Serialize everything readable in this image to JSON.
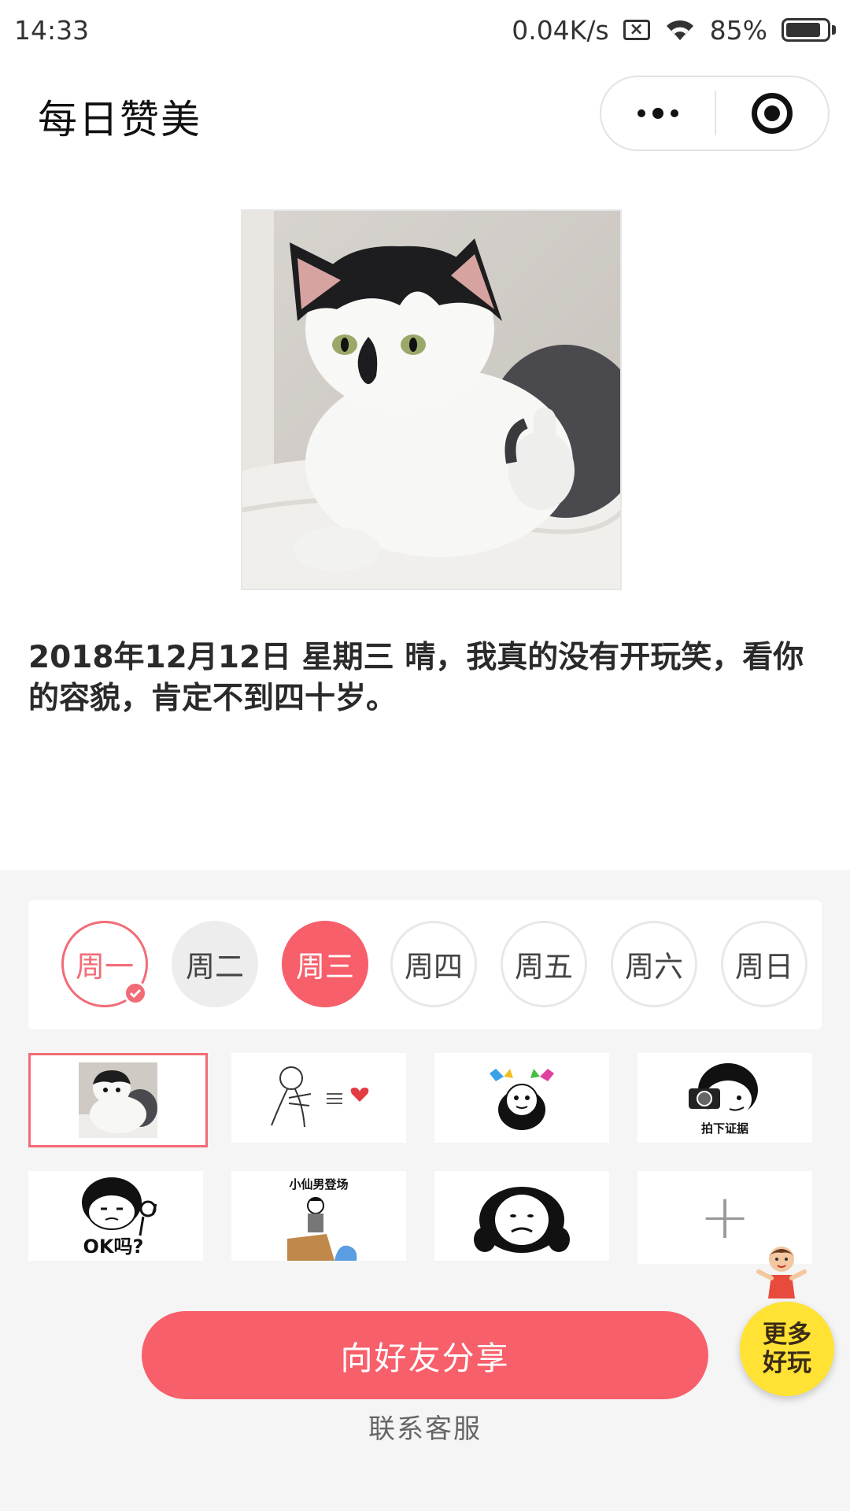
{
  "status_bar": {
    "time": "14:33",
    "network_speed": "0.04K/s",
    "battery_percent": "85%",
    "battery_level": 0.85,
    "icons": [
      "sim-disabled-icon",
      "wifi-icon",
      "battery-icon"
    ]
  },
  "nav": {
    "title": "每日赞美",
    "more_icon": "more-dots-icon",
    "close_icon": "target-close-icon"
  },
  "message": "2018年12月12日 星期三 晴，我真的没有开玩笑，看你的容貌，肯定不到四十岁。",
  "days": [
    {
      "label": "周一",
      "state": "done"
    },
    {
      "label": "周二",
      "state": "gray"
    },
    {
      "label": "周三",
      "state": "selected"
    },
    {
      "label": "周四",
      "state": "normal"
    },
    {
      "label": "周五",
      "state": "normal"
    },
    {
      "label": "周六",
      "state": "normal"
    },
    {
      "label": "周日",
      "state": "normal"
    }
  ],
  "stickers": {
    "row1": [
      "cat-thumbs-up",
      "stick-figure-heart",
      "panda-pinwheels",
      "camera-meme"
    ],
    "row1_captions": {
      "camera_meme": "拍下证据"
    },
    "row2": [
      "ok-meme",
      "xiaoxian-meme",
      "panda-face",
      "add"
    ],
    "row2_captions": {
      "ok_meme": "OK吗?",
      "xiaoxian_meme": "小仙男登场"
    },
    "add_symbol": "+"
  },
  "share_button": "向好友分享",
  "service_link": "联系客服",
  "more_fun": {
    "line1": "更多",
    "line2": "好玩"
  },
  "colors": {
    "accent": "#f75f6b",
    "panel_bg": "#f5f5f5",
    "fab": "#ffe233"
  }
}
